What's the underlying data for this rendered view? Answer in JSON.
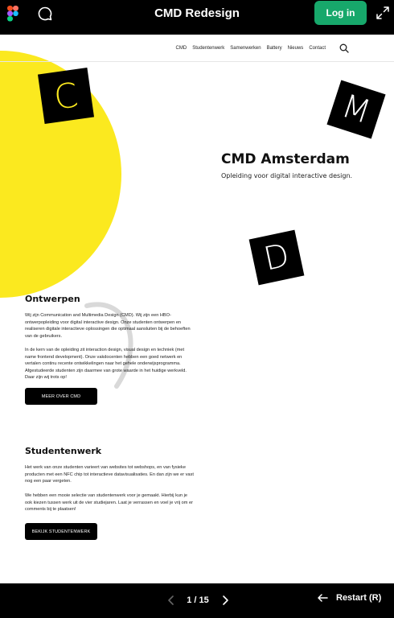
{
  "topbar": {
    "title": "CMD Redesign",
    "login_label": "Log in"
  },
  "nav": {
    "links": [
      "CMD",
      "Studentenwerk",
      "Samenwerken",
      "Battery",
      "Nieuws",
      "Contact"
    ]
  },
  "hero": {
    "title": "CMD Amsterdam",
    "subtitle": "Opleiding voor digital interactive design.",
    "letters": [
      "C",
      "M",
      "D"
    ]
  },
  "sections": [
    {
      "title": "Ontwerpen",
      "paragraphs": [
        "Wij zijn Communication and Multimedia Design (CMD). Wij zijn een HBO-ontwerpopleiding voor digital interactive design. Onze studenten ontwerpen en realiseren digitale interactieve oplossingen die optimaal aansluiten bij de behoeften van de gebruikers.",
        "In de kern van de opleiding zit interaction design, visual design en techniek (met name frontend development). Onze vakdocenten hebben een goed netwerk en vertalen continu recente ontwikkelingen naar het gehele onderwijsprogramma. Afgestudeerde studenten zijn daarmee van grote waarde in het huidige werkveld. Daar zijn wij trots op!"
      ],
      "button": "MEER OVER CMD"
    },
    {
      "title": "Studentenwerk",
      "paragraphs": [
        "Het werk van onze studenten varieert van websites tot webshops, en van fysieke producten met een NFC chip tot interactieve datavisualisaties. En dan zijn we er vast nog een paar vergeten.",
        "We hebben een mooie selectie van studentenwerk voor je gemaakt. Hierbij kun je ook kiezen tussen werk uit de vier studiejaren. Laat je verrassen en voel je vrij om er comments bij te plaatsen!"
      ],
      "button": "BEKIJK STUDENTENWERK"
    }
  ],
  "bottombar": {
    "page_indicator": "1 / 15",
    "restart_label": "Restart (R)"
  },
  "colors": {
    "accent_yellow": "#fbe91f",
    "login_green": "#17a86b",
    "bar_black": "#000000"
  }
}
